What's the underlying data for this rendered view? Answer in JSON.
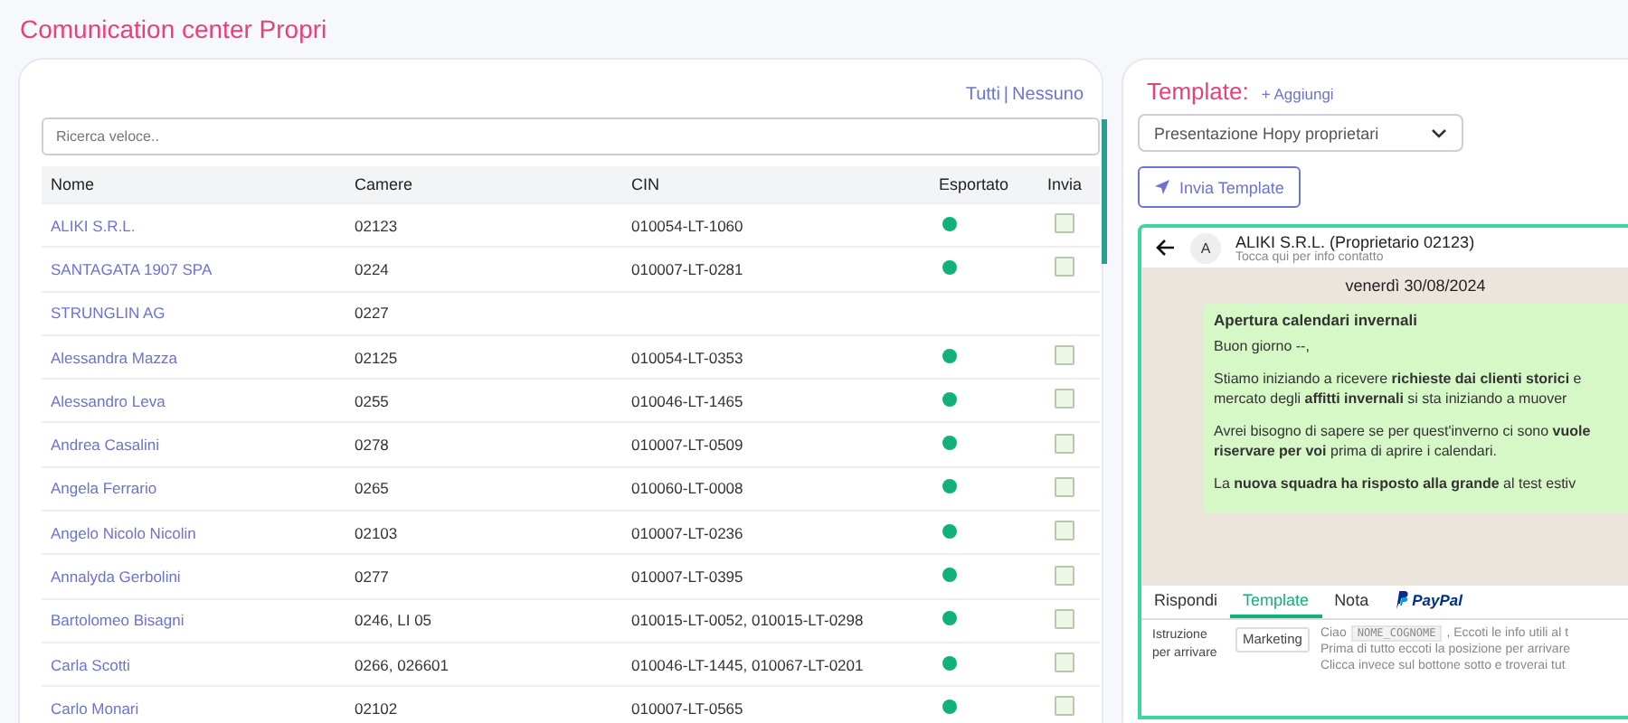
{
  "page_title": "Comunication center Propri",
  "select_links": [
    "Tutti",
    "Nessuno"
  ],
  "link_separator": "|",
  "search": {
    "placeholder": "Ricerca veloce.."
  },
  "table": {
    "columns": [
      "Nome",
      "Camere",
      "CIN",
      "Esportato",
      "Invia"
    ],
    "rows": [
      {
        "name": "ALIKI S.R.L.",
        "camere": "02123",
        "cin": "010054-LT-1060",
        "exported": true,
        "sendable": true,
        "checked": false
      },
      {
        "name": "SANTAGATA 1907 SPA",
        "camere": "0224",
        "cin": "010007-LT-0281",
        "exported": true,
        "sendable": true,
        "checked": false
      },
      {
        "name": "STRUNGLIN AG",
        "camere": "0227",
        "cin": "",
        "exported": false,
        "sendable": false
      },
      {
        "name": "Alessandra Mazza",
        "camere": "02125",
        "cin": "010054-LT-0353",
        "exported": true,
        "sendable": true,
        "checked": false
      },
      {
        "name": "Alessandro Leva",
        "camere": "0255",
        "cin": "010046-LT-1465",
        "exported": true,
        "sendable": true,
        "checked": false
      },
      {
        "name": "Andrea Casalini",
        "camere": "0278",
        "cin": "010007-LT-0509",
        "exported": true,
        "sendable": true,
        "checked": false
      },
      {
        "name": "Angela Ferrario",
        "camere": "0265",
        "cin": "010060-LT-0008",
        "exported": true,
        "sendable": true,
        "checked": false
      },
      {
        "name": "Angelo Nicolo Nicolin",
        "camere": "02103",
        "cin": "010007-LT-0236",
        "exported": true,
        "sendable": true,
        "checked": false
      },
      {
        "name": "Annalyda Gerbolini",
        "camere": "0277",
        "cin": "010007-LT-0395",
        "exported": true,
        "sendable": true,
        "checked": false
      },
      {
        "name": "Bartolomeo Bisagni",
        "camere": "0246, LI 05",
        "cin": "010015-LT-0052, 010015-LT-0298",
        "exported": true,
        "sendable": true,
        "checked": false
      },
      {
        "name": "Carla Scotti",
        "camere": "0266, 026601",
        "cin": "010046-LT-1445, 010067-LT-0201",
        "exported": true,
        "sendable": true,
        "checked": false
      },
      {
        "name": "Carlo Monari",
        "camere": "02102",
        "cin": "010007-LT-0565",
        "exported": true,
        "sendable": true,
        "checked": false
      }
    ]
  },
  "template": {
    "title": "Template:",
    "add_link": "+ Aggiungi",
    "dropdown": "Presentazione Hopy proprietari",
    "send_button": "Invia Template"
  },
  "chat": {
    "avatar": "A",
    "contact": "ALIKI S.R.L. (Proprietario 02123)",
    "subtitle": "Tocca qui per info contatto",
    "date": "venerdì 30/08/2024",
    "message_title": "Apertura calendari invernali",
    "paragraphs": [
      "Buon giorno --,",
      "Stiamo iniziando a ricevere **richieste dai clienti storici** e mercato degli **affitti invernali** si sta iniziando a muover",
      "Avrei bisogno di sapere se per quest'inverno ci sono **vuole riservare per voi** prima di aprire i calendari.",
      "La **nuova squadra ha risposto alla grande** al test estiv"
    ]
  },
  "compose_tabs": [
    {
      "label": "Rispondi",
      "kind": "text",
      "selected": false
    },
    {
      "label": "Template",
      "kind": "text",
      "selected": true
    },
    {
      "label": "Nota",
      "kind": "text",
      "selected": false
    },
    {
      "label": "PayPal",
      "kind": "paypal",
      "selected": false
    }
  ],
  "template_row": {
    "name": "Istruzione per arrivare",
    "category": "Marketing",
    "lines": [
      "Ciao",
      "Prima di tutto eccoti la posizione per arrivare",
      "Clicca invece sul bottone sotto e troverai tut"
    ],
    "variable": "NOME_COGNOME",
    "after_variable": ", Eccoti le info utili al t"
  }
}
